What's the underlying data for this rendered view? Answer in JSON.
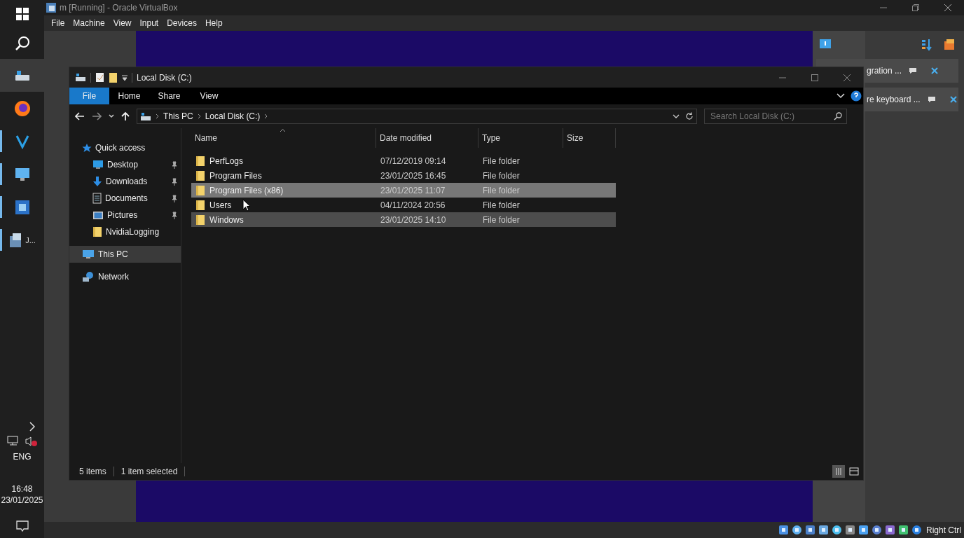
{
  "vbox": {
    "title": "m [Running] - Oracle VirtualBox",
    "menu": [
      "File",
      "Machine",
      "View",
      "Input",
      "Devices",
      "Help"
    ],
    "host_key": "Right Ctrl"
  },
  "taskbar": {
    "apps": [
      {
        "kind": "drive",
        "selected": true,
        "running": false
      },
      {
        "kind": "browser",
        "selected": false,
        "running": false
      },
      {
        "kind": "editor",
        "selected": false,
        "running": true
      },
      {
        "kind": "monitor",
        "selected": false,
        "running": true
      },
      {
        "kind": "vbox",
        "selected": false,
        "running": true
      },
      {
        "kind": "setup",
        "selected": false,
        "running": true,
        "label": "J..."
      }
    ],
    "language": "ENG",
    "time": "16:48",
    "date": "23/01/2025"
  },
  "notifications": [
    {
      "text": "gration ..."
    },
    {
      "text": "re keyboard ..."
    }
  ],
  "explorer": {
    "title": "Local Disk (C:)",
    "ribbon_tabs": [
      {
        "label": "File",
        "selected": true
      },
      {
        "label": "Home",
        "selected": false
      },
      {
        "label": "Share",
        "selected": false
      },
      {
        "label": "View",
        "selected": false
      }
    ],
    "breadcrumb": [
      "This PC",
      "Local Disk (C:)"
    ],
    "search": {
      "placeholder": "Search Local Disk (C:)"
    },
    "nav": [
      {
        "label": "Quick access",
        "kind": "star",
        "selected": false,
        "pinned": false,
        "children": [
          {
            "label": "Desktop",
            "kind": "desktop",
            "selected": false,
            "pinned": true
          },
          {
            "label": "Downloads",
            "kind": "download",
            "selected": false,
            "pinned": true
          },
          {
            "label": "Documents",
            "kind": "document",
            "selected": false,
            "pinned": true
          },
          {
            "label": "Pictures",
            "kind": "pictures",
            "selected": false,
            "pinned": true
          },
          {
            "label": "NvidiaLogging",
            "kind": "folder",
            "selected": false,
            "pinned": false
          }
        ]
      },
      {
        "label": "This PC",
        "kind": "pc",
        "selected": true,
        "pinned": false
      },
      {
        "label": "Network",
        "kind": "network",
        "selected": false,
        "pinned": false
      }
    ],
    "columns": [
      "Name",
      "Date modified",
      "Type",
      "Size"
    ],
    "rows": [
      {
        "name": "PerfLogs",
        "date": "07/12/2019 09:14",
        "type": "File folder",
        "selected": false,
        "hover": false
      },
      {
        "name": "Program Files",
        "date": "23/01/2025 16:45",
        "type": "File folder",
        "selected": false,
        "hover": false
      },
      {
        "name": "Program Files (x86)",
        "date": "23/01/2025 11:07",
        "type": "File folder",
        "selected": true,
        "hover": false
      },
      {
        "name": "Users",
        "date": "04/11/2024 20:56",
        "type": "File folder",
        "selected": false,
        "hover": false
      },
      {
        "name": "Windows",
        "date": "23/01/2025 14:10",
        "type": "File folder",
        "selected": false,
        "hover": true
      }
    ],
    "status": [
      "5 items",
      "1 item selected"
    ]
  }
}
